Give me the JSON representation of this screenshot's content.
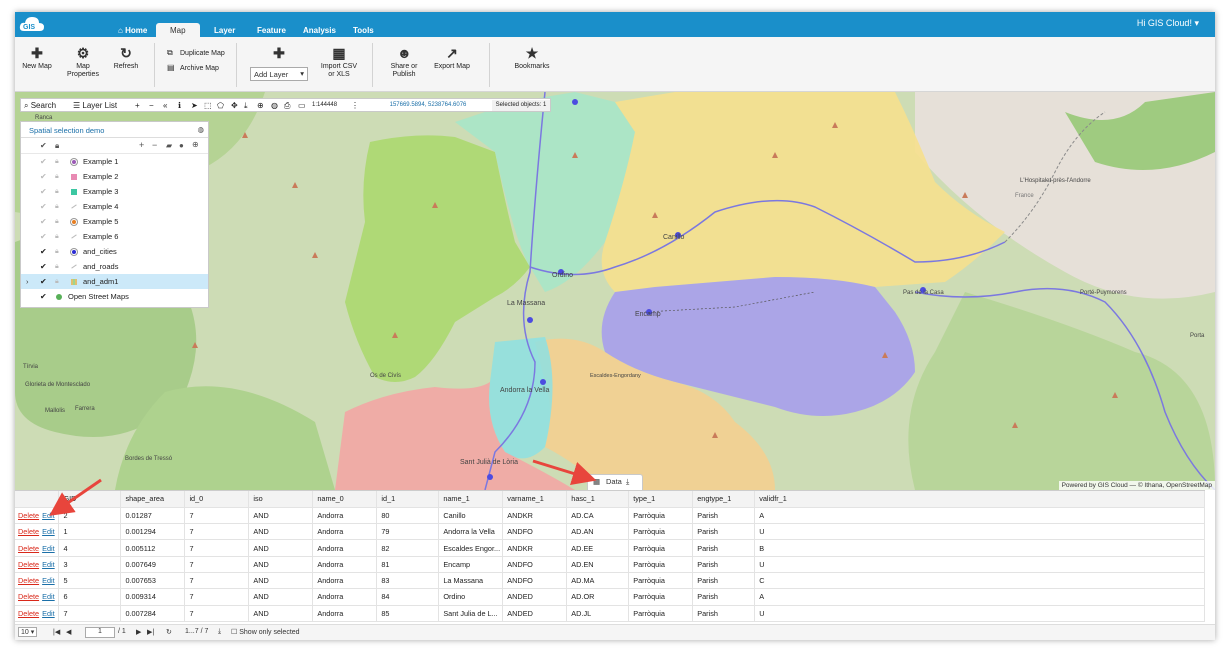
{
  "app": {
    "logo": "GIS",
    "greeting": "Hi GIS Cloud!",
    "nav": [
      "Home",
      "Map",
      "Layer",
      "Feature",
      "Analysis",
      "Tools"
    ],
    "active_tab": "Map"
  },
  "ribbon": {
    "new_map": "New Map",
    "map_properties_1": "Map",
    "map_properties_2": "Properties",
    "refresh": "Refresh",
    "duplicate_map": "Duplicate Map",
    "archive_map": "Archive Map",
    "add_layer": "Add Layer",
    "import_1": "Import CSV",
    "import_2": "or XLS",
    "share_1": "Share or",
    "share_2": "Publish",
    "export_map": "Export Map",
    "bookmarks": "Bookmarks"
  },
  "map_toolbar": {
    "search": "Search",
    "layer_list": "Layer List",
    "scale": "1:144448",
    "coords": "157669.5894, 5238764.6076",
    "selected": "Selected objects: 1"
  },
  "layer_panel": {
    "title": "Spatial selection demo",
    "layers": [
      {
        "name": "Example 1",
        "checked": false,
        "color": "#9b59b6",
        "shape": "circle"
      },
      {
        "name": "Example 2",
        "checked": false,
        "color": "#e88ab3",
        "shape": "square"
      },
      {
        "name": "Example 3",
        "checked": false,
        "color": "#3cc7a2",
        "shape": "square"
      },
      {
        "name": "Example 4",
        "checked": false,
        "color": "#bbbbbb",
        "shape": "line"
      },
      {
        "name": "Example 5",
        "checked": false,
        "color": "#e67e22",
        "shape": "circle"
      },
      {
        "name": "Example 6",
        "checked": false,
        "color": "#bbbbbb",
        "shape": "line"
      },
      {
        "name": "and_cities",
        "checked": true,
        "color": "#2b2bd4",
        "shape": "circle"
      },
      {
        "name": "and_roads",
        "checked": true,
        "color": "#bbbbbb",
        "shape": "line"
      },
      {
        "name": "and_adm1",
        "checked": true,
        "color": "#e0c070",
        "shape": "grid"
      },
      {
        "name": "Open Street Maps",
        "checked": true,
        "color": "#58b058",
        "shape": "globe"
      }
    ]
  },
  "map_labels": {
    "powered_by": "Powered by GIS Cloud — © Ithana, OpenStreetMap",
    "places": [
      "Ordino",
      "La Massana",
      "Encamp",
      "Canillo",
      "Andorra la Vella",
      "Escaldes-Engordany",
      "Sant Julià de Lòria",
      "L'Hospitalet-près-l'Andorre",
      "Porté-Puymorens",
      "Pas de la Casa",
      "Os de Civís",
      "Glorieta de Montesclado",
      "Farrera",
      "Mallolis",
      "Bordes de Tressó",
      "Tírvia",
      "France",
      "Porta",
      "Ranca"
    ]
  },
  "data_tab": "Data",
  "table": {
    "delete_label": "Delete",
    "edit_label": "Edit",
    "columns": [
      "GID",
      "shape_area",
      "id_0",
      "iso",
      "name_0",
      "id_1",
      "name_1",
      "varname_1",
      "hasc_1",
      "type_1",
      "engtype_1",
      "validfr_1"
    ],
    "rows": [
      [
        "2",
        "0.01287",
        "7",
        "AND",
        "Andorra",
        "80",
        "Canillo",
        "ANDKR",
        "AD.CA",
        "Parròquia",
        "Parish",
        "A"
      ],
      [
        "1",
        "0.001294",
        "7",
        "AND",
        "Andorra",
        "79",
        "Andorra la Vella",
        "ANDFO",
        "AD.AN",
        "Parròquia",
        "Parish",
        "U"
      ],
      [
        "4",
        "0.005112",
        "7",
        "AND",
        "Andorra",
        "82",
        "Escaldes Engor...",
        "ANDKR",
        "AD.EE",
        "Parròquia",
        "Parish",
        "B"
      ],
      [
        "3",
        "0.007649",
        "7",
        "AND",
        "Andorra",
        "81",
        "Encamp",
        "ANDFO",
        "AD.EN",
        "Parròquia",
        "Parish",
        "U"
      ],
      [
        "5",
        "0.007653",
        "7",
        "AND",
        "Andorra",
        "83",
        "La Massana",
        "ANDFO",
        "AD.MA",
        "Parròquia",
        "Parish",
        "C"
      ],
      [
        "6",
        "0.009314",
        "7",
        "AND",
        "Andorra",
        "84",
        "Ordino",
        "ANDED",
        "AD.OR",
        "Parròquia",
        "Parish",
        "A"
      ],
      [
        "7",
        "0.007284",
        "7",
        "AND",
        "Andorra",
        "85",
        "Sant Julia de L...",
        "ANDED",
        "AD.JL",
        "Parròquia",
        "Parish",
        "U"
      ]
    ]
  },
  "pager": {
    "page_size": "10",
    "page": "1",
    "of": "/ 1",
    "range": "1...7 / 7",
    "show_only_selected": "Show only selected"
  }
}
